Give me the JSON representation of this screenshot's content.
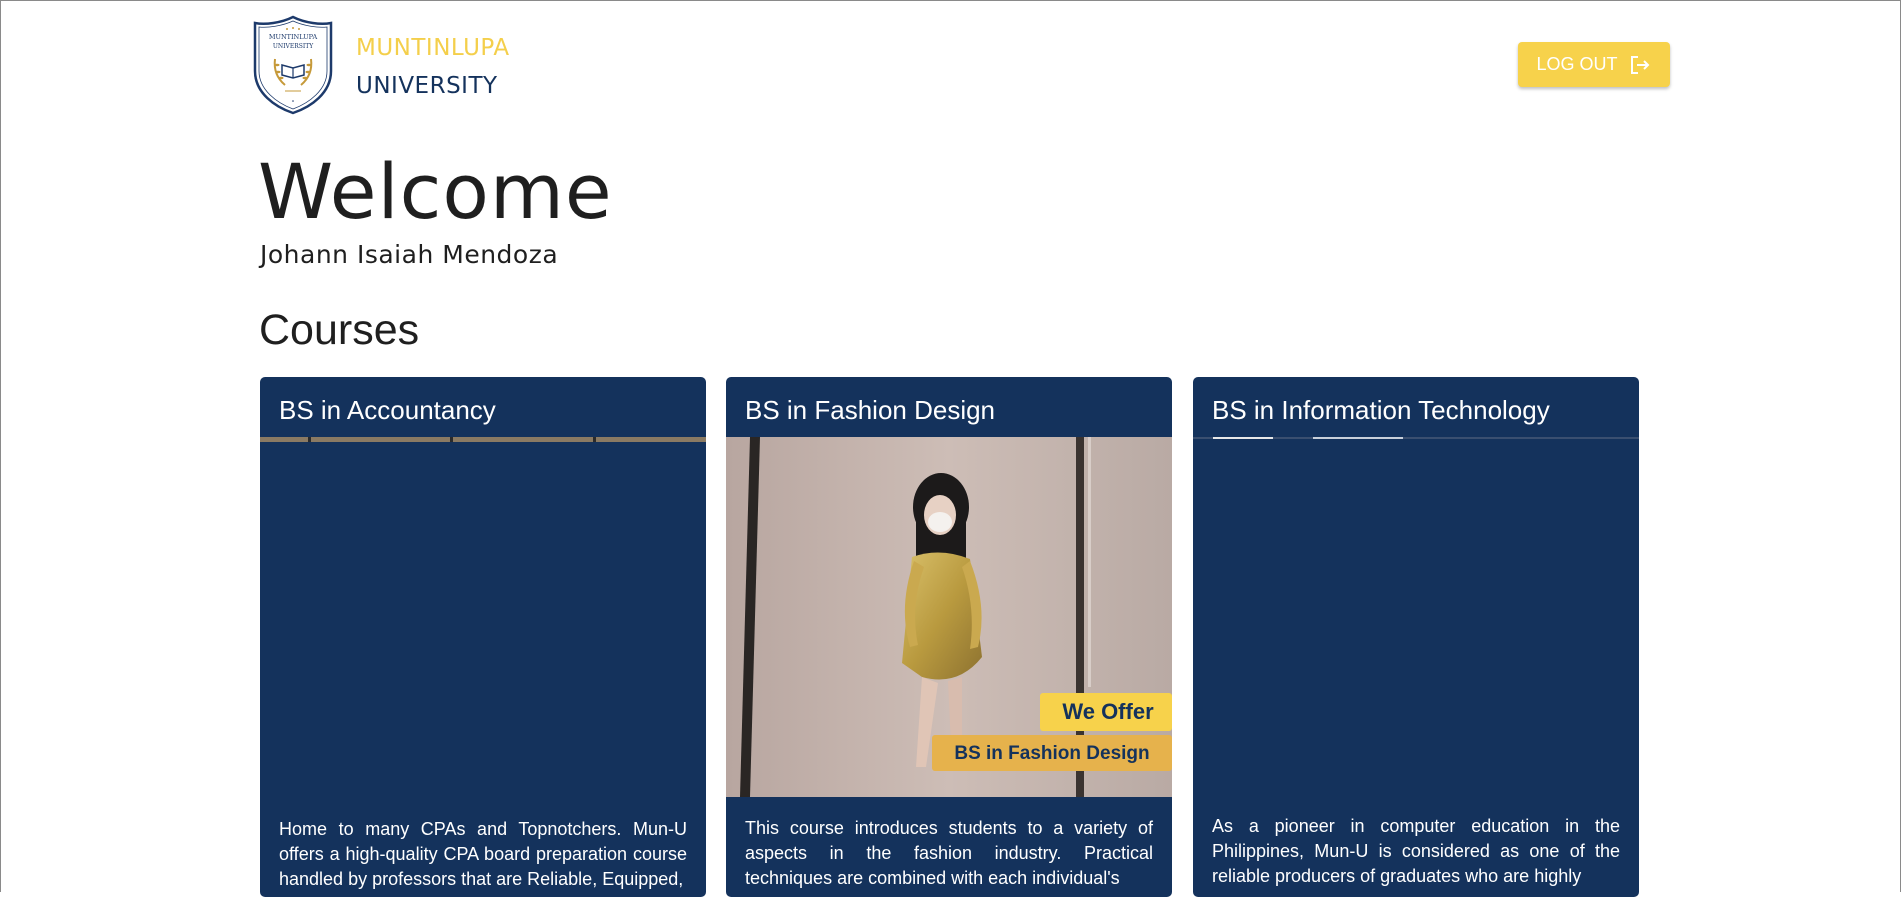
{
  "header": {
    "brand_top": "MUNTINLUPA",
    "brand_bottom": "UNIVERSITY",
    "logo_arc_text": "MUNTINLUPA",
    "logo_banner_text": "UNIVERSITY",
    "logout_label": "LOG OUT",
    "logout_icon": "logout-icon"
  },
  "welcome": {
    "title": "Welcome",
    "user_name": "Johann Isaiah Mendoza"
  },
  "courses": {
    "heading": "Courses",
    "items": [
      {
        "title": "BS in Accountancy",
        "description": "Home to many CPAs and Topnotchers. Mun-U offers a high-quality CPA board preparation course handled by professors that are Reliable, Equipped,"
      },
      {
        "title": "BS in Fashion Design",
        "description": "This course introduces students to a variety of aspects in the fashion industry. Practical techniques are combined with each individual's",
        "badge_top": "We Offer",
        "badge_bottom": "BS in Fashion Design"
      },
      {
        "title": "BS in Information Technology",
        "description": "As a pioneer in computer education in the Philippines, Mun-U is considered as one of the reliable producers of graduates who are highly"
      }
    ]
  },
  "colors": {
    "primary_navy": "#14325c",
    "accent_yellow": "#f7d24b",
    "brand_gold": "#f4cf4b"
  }
}
